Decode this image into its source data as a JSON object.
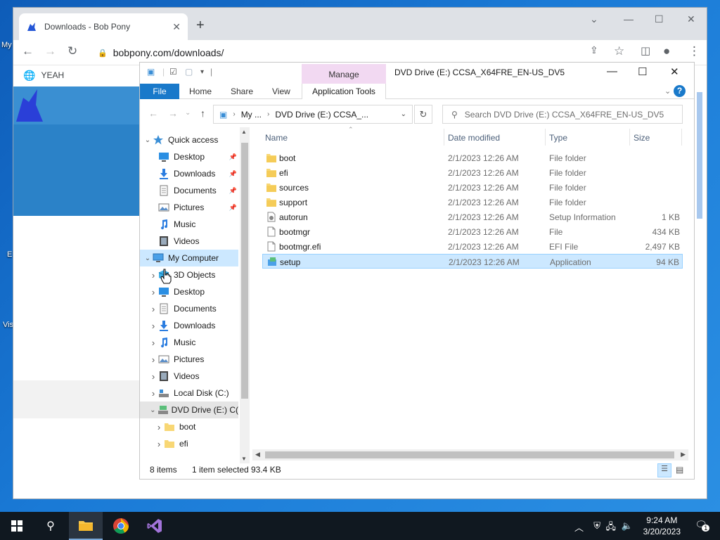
{
  "desktop": {
    "labels": [
      "My",
      "E",
      "Vis"
    ]
  },
  "browser": {
    "tab_title": "Downloads - Bob Pony",
    "tab_close": "✕",
    "new_tab": "+",
    "url": "bobpony.com/downloads/",
    "bookmark": "YEAH",
    "window_controls": {
      "dropdown": "⌄",
      "minimize": "—",
      "maximize": "☐",
      "close": "✕"
    }
  },
  "explorer": {
    "title": "DVD Drive (E:) CCSA_X64FRE_EN-US_DV5",
    "manage_label": "Manage",
    "ribbon_tabs": [
      "File",
      "Home",
      "Share",
      "View"
    ],
    "app_tools_label": "Application Tools",
    "help": "?",
    "address": {
      "root": "My ...",
      "current": "DVD Drive (E:) CCSA_..."
    },
    "search_placeholder": "Search DVD Drive (E:) CCSA_X64FRE_EN-US_DV5",
    "nav_tree": [
      {
        "label": "Quick access",
        "level": 0,
        "expand": "open",
        "icon": "star",
        "pinned": false
      },
      {
        "label": "Desktop",
        "level": 1,
        "expand": "",
        "icon": "desktop",
        "pinned": true
      },
      {
        "label": "Downloads",
        "level": 1,
        "expand": "",
        "icon": "download",
        "pinned": true
      },
      {
        "label": "Documents",
        "level": 1,
        "expand": "",
        "icon": "document",
        "pinned": true
      },
      {
        "label": "Pictures",
        "level": 1,
        "expand": "",
        "icon": "picture",
        "pinned": true
      },
      {
        "label": "Music",
        "level": 1,
        "expand": "",
        "icon": "music",
        "pinned": false
      },
      {
        "label": "Videos",
        "level": 1,
        "expand": "",
        "icon": "video",
        "pinned": false
      },
      {
        "label": "My Computer",
        "level": 0,
        "expand": "open",
        "icon": "computer",
        "pinned": false,
        "state": "selected"
      },
      {
        "label": "3D Objects",
        "level": 1,
        "expand": "closed",
        "icon": "cube",
        "pinned": false
      },
      {
        "label": "Desktop",
        "level": 1,
        "expand": "closed",
        "icon": "desktop",
        "pinned": false
      },
      {
        "label": "Documents",
        "level": 1,
        "expand": "closed",
        "icon": "document",
        "pinned": false
      },
      {
        "label": "Downloads",
        "level": 1,
        "expand": "closed",
        "icon": "download",
        "pinned": false
      },
      {
        "label": "Music",
        "level": 1,
        "expand": "closed",
        "icon": "music",
        "pinned": false
      },
      {
        "label": "Pictures",
        "level": 1,
        "expand": "closed",
        "icon": "picture",
        "pinned": false
      },
      {
        "label": "Videos",
        "level": 1,
        "expand": "closed",
        "icon": "video",
        "pinned": false
      },
      {
        "label": "Local Disk (C:)",
        "level": 1,
        "expand": "closed",
        "icon": "disk",
        "pinned": false
      },
      {
        "label": "DVD Drive (E:) C(",
        "level": 1,
        "expand": "open",
        "icon": "dvd",
        "pinned": false,
        "state": "highlighted"
      },
      {
        "label": "boot",
        "level": 2,
        "expand": "closed",
        "icon": "folder",
        "pinned": false
      },
      {
        "label": "efi",
        "level": 2,
        "expand": "closed",
        "icon": "folder",
        "pinned": false
      }
    ],
    "columns": [
      "Name",
      "Date modified",
      "Type",
      "Size"
    ],
    "files": [
      {
        "name": "boot",
        "date": "2/1/2023 12:26 AM",
        "type": "File folder",
        "size": "",
        "icon": "folder"
      },
      {
        "name": "efi",
        "date": "2/1/2023 12:26 AM",
        "type": "File folder",
        "size": "",
        "icon": "folder"
      },
      {
        "name": "sources",
        "date": "2/1/2023 12:26 AM",
        "type": "File folder",
        "size": "",
        "icon": "folder"
      },
      {
        "name": "support",
        "date": "2/1/2023 12:26 AM",
        "type": "File folder",
        "size": "",
        "icon": "folder"
      },
      {
        "name": "autorun",
        "date": "2/1/2023 12:26 AM",
        "type": "Setup Information",
        "size": "1 KB",
        "icon": "setup-info"
      },
      {
        "name": "bootmgr",
        "date": "2/1/2023 12:26 AM",
        "type": "File",
        "size": "434 KB",
        "icon": "file"
      },
      {
        "name": "bootmgr.efi",
        "date": "2/1/2023 12:26 AM",
        "type": "EFI File",
        "size": "2,497 KB",
        "icon": "file"
      },
      {
        "name": "setup",
        "date": "2/1/2023 12:26 AM",
        "type": "Application",
        "size": "94 KB",
        "icon": "app",
        "selected": true
      }
    ],
    "status": {
      "items": "8 items",
      "selected": "1 item selected",
      "size": "93.4 KB"
    }
  },
  "taskbar": {
    "time": "9:24 AM",
    "date": "3/20/2023",
    "notifications": "1"
  },
  "colors": {
    "file_tab": "#1979ca",
    "selection": "#cce8ff",
    "manage_tab": "#f2d9f2",
    "folder": "#f8d775"
  }
}
